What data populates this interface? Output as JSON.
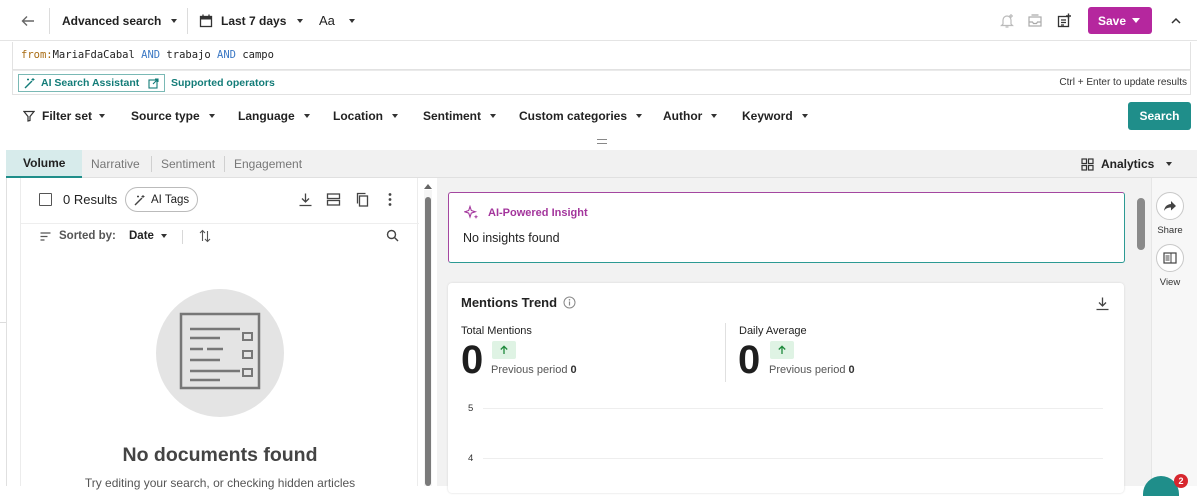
{
  "header": {
    "search_mode": "Advanced search",
    "date_range": "Last 7 days",
    "text_size_label": "Aa",
    "save_label": "Save",
    "icons": [
      "back-arrow-icon",
      "calendar-icon",
      "alert-add-icon",
      "inbox-icon",
      "add-report-icon",
      "collapse-icon"
    ]
  },
  "query": {
    "key": "from:",
    "author": "MariaFdaCabal",
    "op1": "AND",
    "term1": "trabajo",
    "op2": "AND",
    "term2": "campo"
  },
  "assistant": {
    "ai_search_assistant": "AI Search Assistant",
    "supported_operators": "Supported operators",
    "update_hint": "Ctrl + Enter to update results"
  },
  "filters": {
    "filter_set": "Filter set",
    "items": [
      "Source type",
      "Language",
      "Location",
      "Sentiment",
      "Custom categories",
      "Author",
      "Keyword"
    ],
    "search_label": "Search"
  },
  "tabs": {
    "items": [
      "Volume",
      "Narrative",
      "Sentiment",
      "Engagement"
    ],
    "active": "Volume",
    "analytics_label": "Analytics"
  },
  "results": {
    "count_label": "0 Results",
    "ai_tags_label": "AI Tags",
    "sorted_by_label": "Sorted by:",
    "sort_value": "Date",
    "empty_title": "No documents found",
    "empty_hint": "Try editing your search, or checking hidden articles"
  },
  "insight": {
    "title": "AI-Powered Insight",
    "text": "No insights found"
  },
  "trend": {
    "title": "Mentions Trend",
    "total_label": "Total Mentions",
    "total_value": "0",
    "total_prev_label": "Previous period",
    "total_prev_value": "0",
    "daily_label": "Daily Average",
    "daily_value": "0",
    "daily_prev_label": "Previous period",
    "daily_prev_value": "0",
    "y_ticks": [
      "5",
      "4"
    ]
  },
  "side": {
    "share_label": "Share",
    "view_label": "View"
  },
  "chat": {
    "badge_count": "2"
  },
  "colors": {
    "save": "#b5279e",
    "accent": "#1f8e8a",
    "insight": "#a3359c"
  }
}
